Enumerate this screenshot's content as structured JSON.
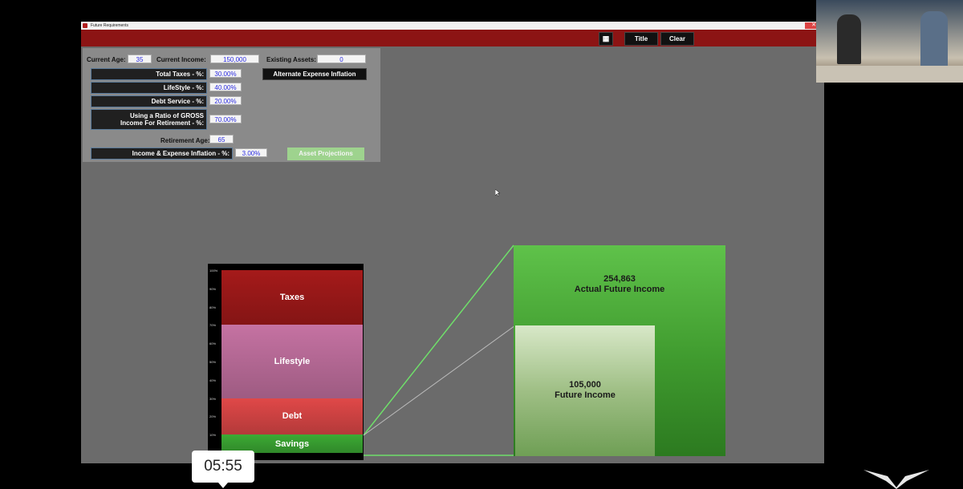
{
  "window": {
    "title": "Future Requirements"
  },
  "toolbar": {
    "title_label": "Title",
    "clear_label": "Clear"
  },
  "inputs": {
    "current_age_label": "Current Age:",
    "current_age": "35",
    "current_income_label": "Current Income:",
    "current_income": "150,000",
    "existing_assets_label": "Existing Assets:",
    "existing_assets": "0",
    "total_taxes_label": "Total Taxes - %:",
    "total_taxes": "30.00%",
    "lifestyle_label": "LifeStyle - %:",
    "lifestyle": "40.00%",
    "debt_service_label": "Debt Service - %:",
    "debt_service": "20.00%",
    "gross_ratio_label_1": "Using a Ratio of GROSS",
    "gross_ratio_label_2": "Income For Retirement - %:",
    "gross_ratio": "70.00%",
    "retirement_age_label": "Retirement Age:",
    "retirement_age": "65",
    "inflation_label": "Income & Expense Inflation - %:",
    "inflation": "3.00%",
    "alt_inflation_button": "Alternate Expense Inflation",
    "asset_projections_button": "Asset Projections"
  },
  "stack": {
    "ticks": [
      "100%",
      "90%",
      "80%",
      "70%",
      "60%",
      "50%",
      "40%",
      "30%",
      "20%",
      "10%",
      "0%"
    ],
    "segments": [
      {
        "label": "Taxes",
        "percent": 30,
        "color": "#a51a1a"
      },
      {
        "label": "Lifestyle",
        "percent": 40,
        "color": "#c572a2"
      },
      {
        "label": "Debt",
        "percent": 20,
        "color": "#e04848"
      },
      {
        "label": "Savings",
        "percent": 10,
        "color": "#3caa34"
      }
    ]
  },
  "projection": {
    "actual_value": "254,863",
    "actual_label": "Actual Future Income",
    "future_value": "105,000",
    "future_label": "Future Income"
  },
  "video": {
    "timestamp": "05:55"
  },
  "colors": {
    "topbar": "#8c1414",
    "accent_green": "#5fc24a"
  }
}
